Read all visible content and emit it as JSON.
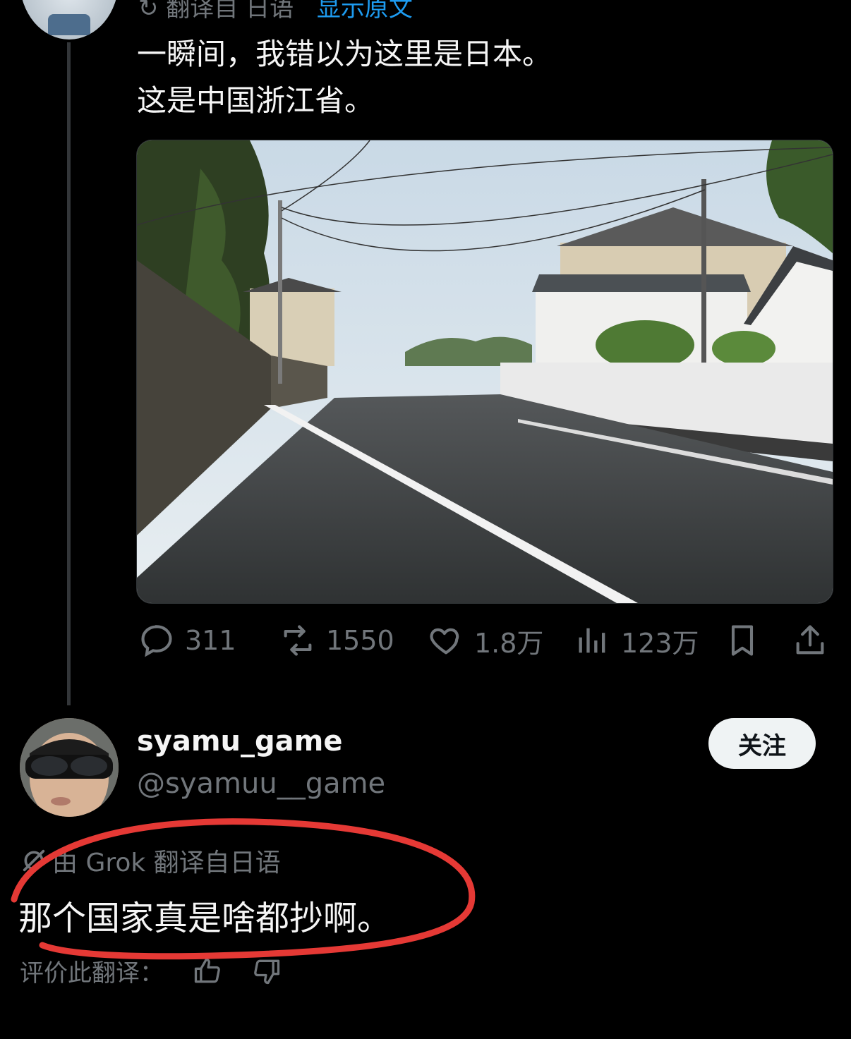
{
  "original_post": {
    "translate_label": "翻译自 日语",
    "show_original": "显示原文",
    "text": "一瞬间，我错以为这里是日本。\n这是中国浙江省。",
    "stats": {
      "replies": "311",
      "retweets": "1550",
      "likes": "1.8万",
      "views": "123万"
    }
  },
  "reply": {
    "display_name": "syamu_game",
    "handle": "@syamuu__game",
    "follow_label": "关注",
    "translation_label": "由 Grok 翻译自日语",
    "text": "那个国家真是啥都抄啊。",
    "rate_label": "评价此翻译："
  },
  "colors": {
    "background": "#000000",
    "text_primary": "#f5f5f5",
    "text_secondary": "#71767b",
    "link": "#1d9bf0",
    "annotation_red": "#e53935"
  }
}
